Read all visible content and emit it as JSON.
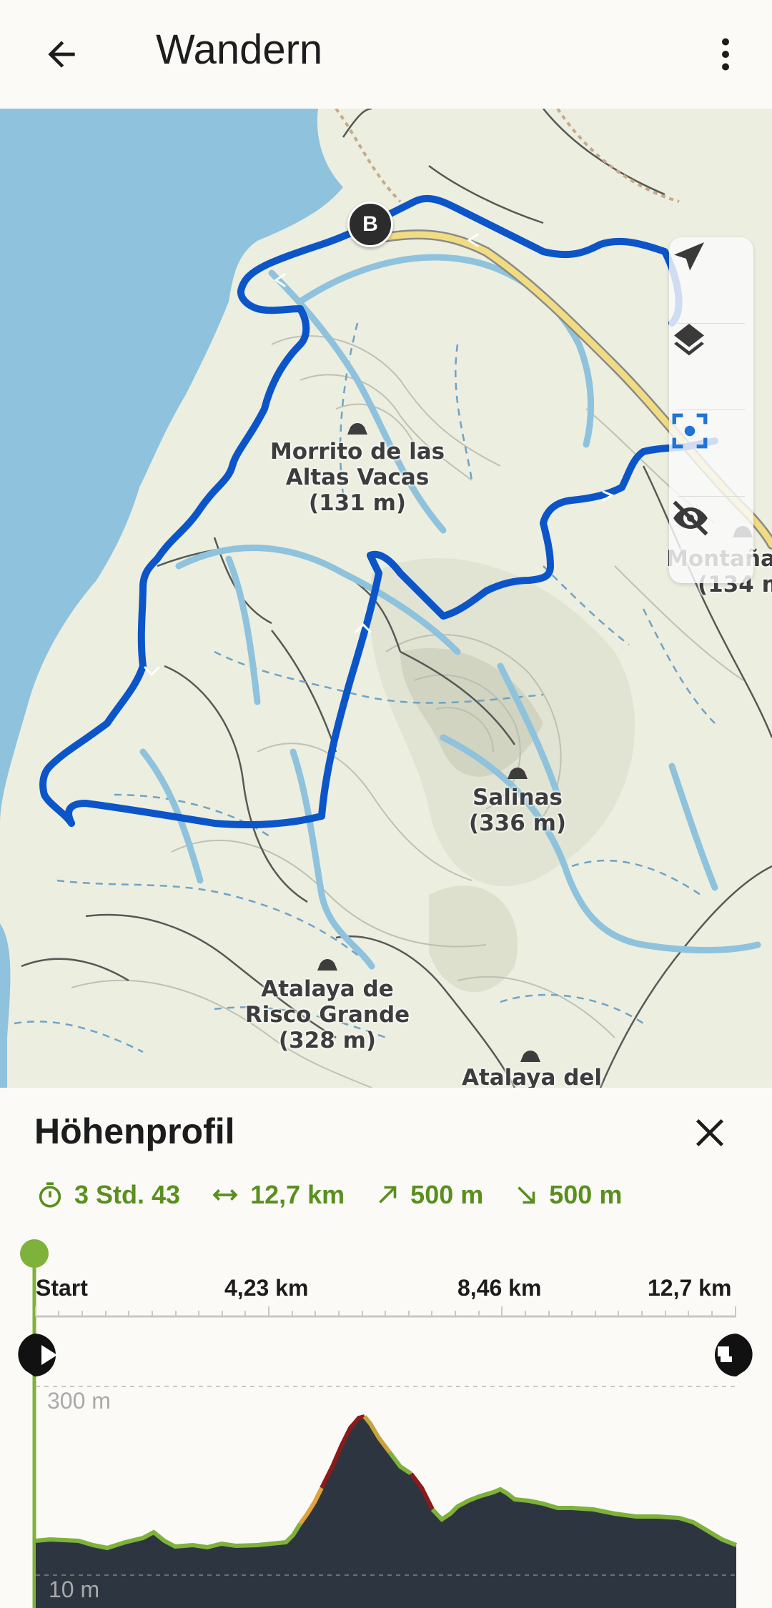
{
  "appbar": {
    "title": "Wandern",
    "back_icon": "arrow-back-icon",
    "more_icon": "more-vert-icon"
  },
  "map": {
    "labels": [
      {
        "name": "Morrito de las Altas Vacas",
        "lines": [
          "Morrito de las",
          "Altas Vacas",
          "(131 m)"
        ]
      },
      {
        "name": "Montaña",
        "lines": [
          "Montaña",
          "(134 m"
        ]
      },
      {
        "name": "Salinas",
        "lines": [
          "Salinas",
          "(336 m)"
        ]
      },
      {
        "name": "Atalaya de Risco Grande",
        "lines": [
          "Atalaya de",
          "Risco Grande",
          "(328 m)"
        ]
      },
      {
        "name": "Atalaya del",
        "lines": [
          "Atalaya del"
        ]
      }
    ],
    "marker_label": "B",
    "controls": [
      "navigation-arrow-icon",
      "layers-icon",
      "focus-location-icon",
      "visibility-off-icon"
    ],
    "colors": {
      "water": "#8fc2dc",
      "land": "#eceee0",
      "route": "#0b55c8",
      "road": "#f2dc82"
    }
  },
  "profile": {
    "title": "Höhenprofil",
    "stats": [
      {
        "icon": "timer-icon",
        "value": "3 Std. 43"
      },
      {
        "icon": "distance-icon",
        "value": "12,7 km"
      },
      {
        "icon": "ascent-icon",
        "value": "500 m"
      },
      {
        "icon": "descent-icon",
        "value": "500 m"
      }
    ],
    "distance_labels": [
      "Start",
      "4,23 km",
      "8,46 km",
      "12,7 km"
    ],
    "elevation_labels": {
      "max": "300 m",
      "min": "10 m"
    },
    "accent_color": "#5a8f1f",
    "fill_color": "#2d3640"
  }
}
